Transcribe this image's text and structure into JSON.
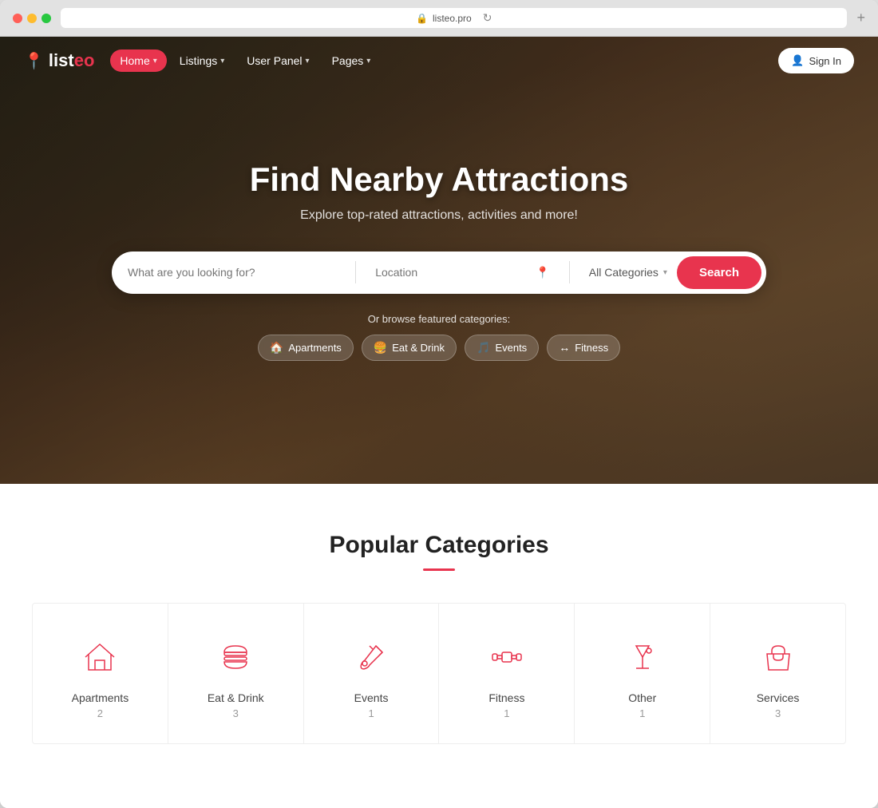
{
  "browser": {
    "url": "listeo.pro",
    "new_tab_label": "+"
  },
  "navbar": {
    "logo_text": "listeo",
    "nav_items": [
      {
        "label": "Home",
        "active": true,
        "has_chevron": true
      },
      {
        "label": "Listings",
        "active": false,
        "has_chevron": true
      },
      {
        "label": "User Panel",
        "active": false,
        "has_chevron": true
      },
      {
        "label": "Pages",
        "active": false,
        "has_chevron": true
      }
    ],
    "signin_label": "Sign In"
  },
  "hero": {
    "title": "Find Nearby Attractions",
    "subtitle": "Explore top-rated attractions, activities and more!",
    "search_placeholder": "What are you looking for?",
    "location_placeholder": "Location",
    "category_label": "All Categories",
    "search_button_label": "Search",
    "browse_label": "Or browse featured categories:",
    "featured_categories": [
      {
        "label": "Apartments",
        "icon": "🏠"
      },
      {
        "label": "Eat & Drink",
        "icon": "🍔"
      },
      {
        "label": "Events",
        "icon": "🎵"
      },
      {
        "label": "Fitness",
        "icon": "↔"
      }
    ]
  },
  "popular_section": {
    "title": "Popular Categories",
    "categories": [
      {
        "name": "Apartments",
        "count": "2"
      },
      {
        "name": "Eat & Drink",
        "count": "3"
      },
      {
        "name": "Events",
        "count": "1"
      },
      {
        "name": "Fitness",
        "count": "1"
      },
      {
        "name": "Other",
        "count": "1"
      },
      {
        "name": "Services",
        "count": "3"
      }
    ]
  }
}
